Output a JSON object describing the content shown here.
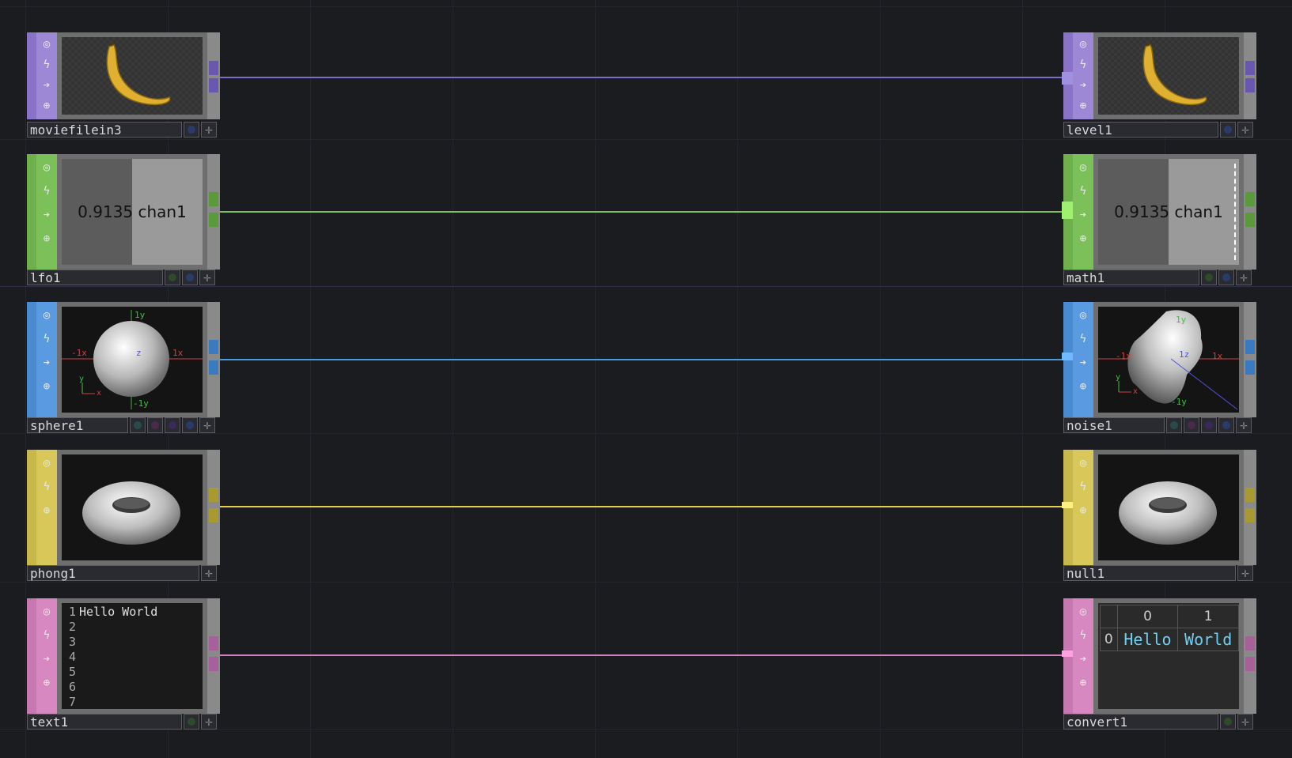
{
  "network": {
    "rows": [
      {
        "family": "TOP",
        "color": "#8a72c8",
        "wire_color": "#7e6cc8",
        "source": {
          "name": "moviefilein3",
          "viewer": "banana-image",
          "flags": [
            "blue"
          ]
        },
        "target": {
          "name": "level1",
          "viewer": "banana-image",
          "flags": [
            "blue"
          ]
        }
      },
      {
        "family": "CHOP",
        "color": "#6fb04c",
        "wire_color": "#7fc050",
        "source": {
          "name": "lfo1",
          "viewer_text": "0.9135 chan1",
          "flags": [
            "green",
            "blue"
          ]
        },
        "target": {
          "name": "math1",
          "viewer_text": "0.9135 chan1",
          "flags": [
            "green",
            "blue"
          ]
        }
      },
      {
        "family": "SOP",
        "color": "#4a8ad0",
        "wire_color": "#4a9ae0",
        "source": {
          "name": "sphere1",
          "viewer": "sphere-geometry",
          "axis_labels": [
            "1y",
            "-1x",
            "1x",
            "-1y",
            "z",
            "y",
            "x"
          ],
          "flags": [
            "teal",
            "purple",
            "purple",
            "blue"
          ]
        },
        "target": {
          "name": "noise1",
          "viewer": "noise-geometry",
          "axis_labels": [
            "1y",
            "-1x",
            "1x",
            "-1y",
            "1z",
            "y",
            "x"
          ],
          "flags": [
            "teal",
            "purple",
            "purple",
            "blue"
          ]
        }
      },
      {
        "family": "MAT",
        "color": "#c8b84c",
        "wire_color": "#e0d04a",
        "source": {
          "name": "phong1",
          "viewer": "torus-material"
        },
        "target": {
          "name": "null1",
          "viewer": "torus-material"
        }
      },
      {
        "family": "DAT",
        "color": "#c878b0",
        "wire_color": "#d080c0",
        "source": {
          "name": "text1",
          "lines": [
            "Hello World",
            "",
            "",
            "",
            "",
            "",
            ""
          ],
          "line_numbers": [
            "1",
            "2",
            "3",
            "4",
            "5",
            "6",
            "7"
          ],
          "flags": [
            "green"
          ]
        },
        "target": {
          "name": "convert1",
          "table": {
            "col_headers": [
              "0",
              "1"
            ],
            "row_headers": [
              "0"
            ],
            "cells": [
              [
                "Hello",
                "World"
              ]
            ]
          },
          "flags": [
            "green"
          ]
        }
      }
    ]
  },
  "icons": {
    "viewer": "eye-target-icon",
    "cook": "bolt-icon",
    "bypass": "arrow-right-icon",
    "lock": "lock-icon",
    "expand": "plus-icon"
  }
}
